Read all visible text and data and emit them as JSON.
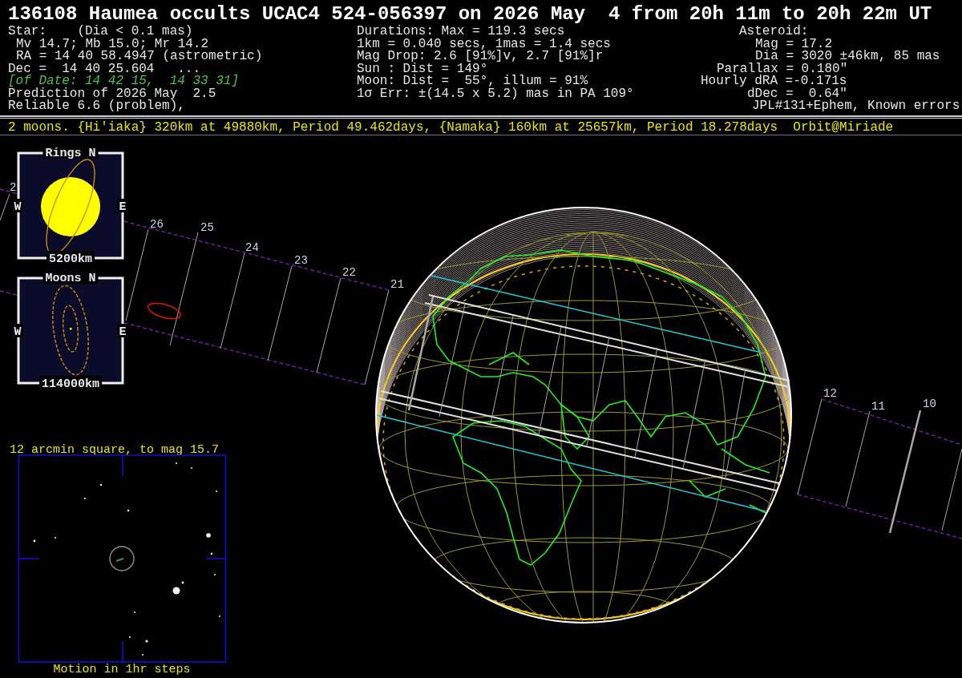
{
  "title": "136108 Haumea occults UCAC4 524-056397 on 2026 May  4 from 20h 11m to 20h 22m UT",
  "star_info": [
    {
      "text": "Star:    (Dia < 0.1 mas)",
      "kind": "plain"
    },
    {
      "text": "Mv 14.7; Mb 15.0; Mr 14.2",
      "kind": "plain"
    },
    {
      "text": "RA = 14 40 58.4947 (astrometric)",
      "kind": "plain"
    },
    {
      "text": "Dec =  14 40 25.604   ...",
      "kind": "plain"
    },
    {
      "text": "[of Date: 14 42 15,  14 33 31]",
      "kind": "of_date"
    },
    {
      "text": "Prediction of 2026 May  2.5",
      "kind": "plain"
    },
    {
      "text": "Reliable 6.6 (problem),",
      "kind": "plain"
    }
  ],
  "event_info": [
    "Durations: Max = 119.3 secs",
    "1km = 0.040 secs, 1mas = 1.4 secs",
    "Mag Drop: 2.6 [91%]v, 2.7 [91%]r",
    "Sun : Dist = 149°",
    "Moon: Dist =  55°, illum = 91%",
    "1σ Err: ±(14.5 x 5.2) mas in PA 109°"
  ],
  "asteroid_info": [
    "Asteroid:",
    "Mag = 17.2",
    "Dia = 3020 ±46km, 85 mas",
    "Parallax = 0.180\"",
    "Hourly dRA =-0.171s",
    "dDec =  0.64\"",
    "JPL#131+Ephem, Known errors"
  ],
  "moons_line": "2 moons. {Hi'iaka} 320km at 49880km, Period 49.462days, {Namaka} 160km at 25657km, Period 18.278days  Orbit@Miriade",
  "map": {
    "minute_labels_west": [
      "2",
      "26",
      "25",
      "24",
      "23",
      "22",
      "21"
    ],
    "minute_labels_east": [
      "12",
      "11",
      "10"
    ],
    "rings_inset": {
      "title": "Rings N",
      "west": "W",
      "east": "E",
      "scale": "5200km"
    },
    "moons_inset": {
      "title": "Moons N",
      "west": "W",
      "east": "E",
      "scale": "114000km"
    },
    "star_chart": {
      "caption": "12 arcmin square, to mag 15.7",
      "footer": "Motion in 1hr steps"
    }
  }
}
